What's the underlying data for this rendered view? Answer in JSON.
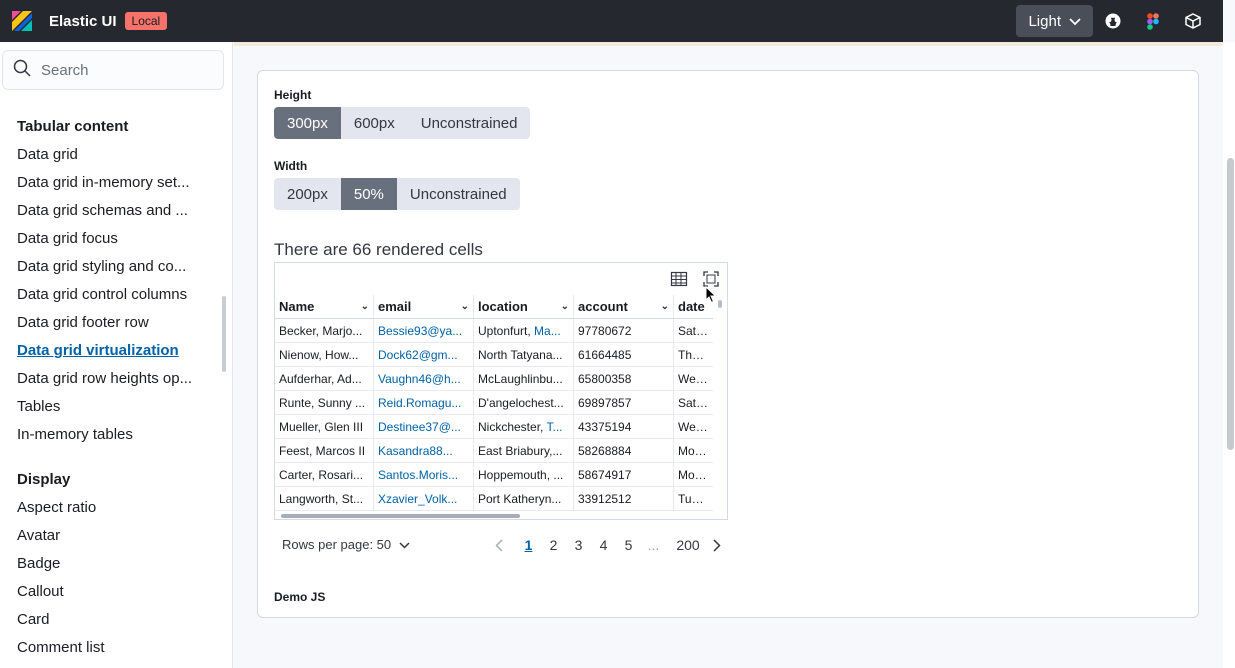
{
  "header": {
    "brand": "Elastic UI",
    "env_badge": "Local",
    "theme_label": "Light"
  },
  "sidebar": {
    "search_placeholder": "Search",
    "groups": [
      {
        "title": "Tabular content",
        "items": [
          {
            "label": "Data grid"
          },
          {
            "label": "Data grid in-memory set..."
          },
          {
            "label": "Data grid schemas and ..."
          },
          {
            "label": "Data grid focus"
          },
          {
            "label": "Data grid styling and co..."
          },
          {
            "label": "Data grid control columns"
          },
          {
            "label": "Data grid footer row"
          },
          {
            "label": "Data grid virtualization",
            "active": true
          },
          {
            "label": "Data grid row heights op..."
          },
          {
            "label": "Tables"
          },
          {
            "label": "In-memory tables"
          }
        ]
      },
      {
        "title": "Display",
        "items": [
          {
            "label": "Aspect ratio"
          },
          {
            "label": "Avatar"
          },
          {
            "label": "Badge"
          },
          {
            "label": "Callout"
          },
          {
            "label": "Card"
          },
          {
            "label": "Comment list"
          }
        ]
      }
    ]
  },
  "height_control": {
    "label": "Height",
    "options": [
      "300px",
      "600px",
      "Unconstrained"
    ],
    "selected": "300px"
  },
  "width_control": {
    "label": "Width",
    "options": [
      "200px",
      "50%",
      "Unconstrained"
    ],
    "selected": "50%"
  },
  "rendered_cells_text": "There are 66 rendered cells",
  "grid": {
    "columns": [
      "Name",
      "email",
      "location",
      "account",
      "date"
    ],
    "rows": [
      {
        "name": "Becker, Marjo...",
        "email": "Bessie93@ya...",
        "location": "Uptonfurt, ",
        "location_link": "Ma...",
        "account": "97780672",
        "date": "Sat Ju"
      },
      {
        "name": "Nienow, How...",
        "email": "Dock62@gm...",
        "location": "North Tatyana...",
        "location_link": "",
        "account": "61664485",
        "date": "Thu A"
      },
      {
        "name": "Aufderhar, Ad...",
        "email": "Vaughn46@h...",
        "location": "McLaughlinbu...",
        "location_link": "",
        "account": "65800358",
        "date": "Wed J"
      },
      {
        "name": "Runte, Sunny ...",
        "email": "Reid.Romagu...",
        "location": "D'angelochest...",
        "location_link": "",
        "account": "69897857",
        "date": "Sat Ap"
      },
      {
        "name": "Mueller, Glen III",
        "email": "Destinee37@...",
        "location": "Nickchester, ",
        "location_link": "T...",
        "account": "43375194",
        "date": "Wed N"
      },
      {
        "name": "Feest, Marcos II",
        "email": "Kasandra88...",
        "location": "East Briabury,...",
        "location_link": "",
        "account": "58268884",
        "date": "Mon C"
      },
      {
        "name": "Carter, Rosari...",
        "email": "Santos.Moris...",
        "location": "Hoppemouth, ...",
        "location_link": "",
        "account": "58674917",
        "date": "Mon J"
      },
      {
        "name": "Langworth, St...",
        "email": "Xzavier_Volk...",
        "location": "Port Katheryn...",
        "location_link": "",
        "account": "33912512",
        "date": "Tue M"
      }
    ]
  },
  "pagination": {
    "rows_per_page_label": "Rows per page: 50",
    "pages": [
      "1",
      "2",
      "3",
      "4",
      "5"
    ],
    "current": "1",
    "ellipsis": "...",
    "last": "200"
  },
  "demo_js_label": "Demo JS",
  "icons": {
    "logo": "elastic-logo-icon",
    "github": "github-icon",
    "figma": "figma-icon",
    "codesandbox": "cube-icon",
    "search": "search-icon",
    "density": "table-density-icon",
    "fullscreen": "fullscreen-icon"
  },
  "colors": {
    "header_bg": "#25282f",
    "accent_link": "#0061a6",
    "badge_local": "#f6726a",
    "selected_button": "#69707d"
  }
}
